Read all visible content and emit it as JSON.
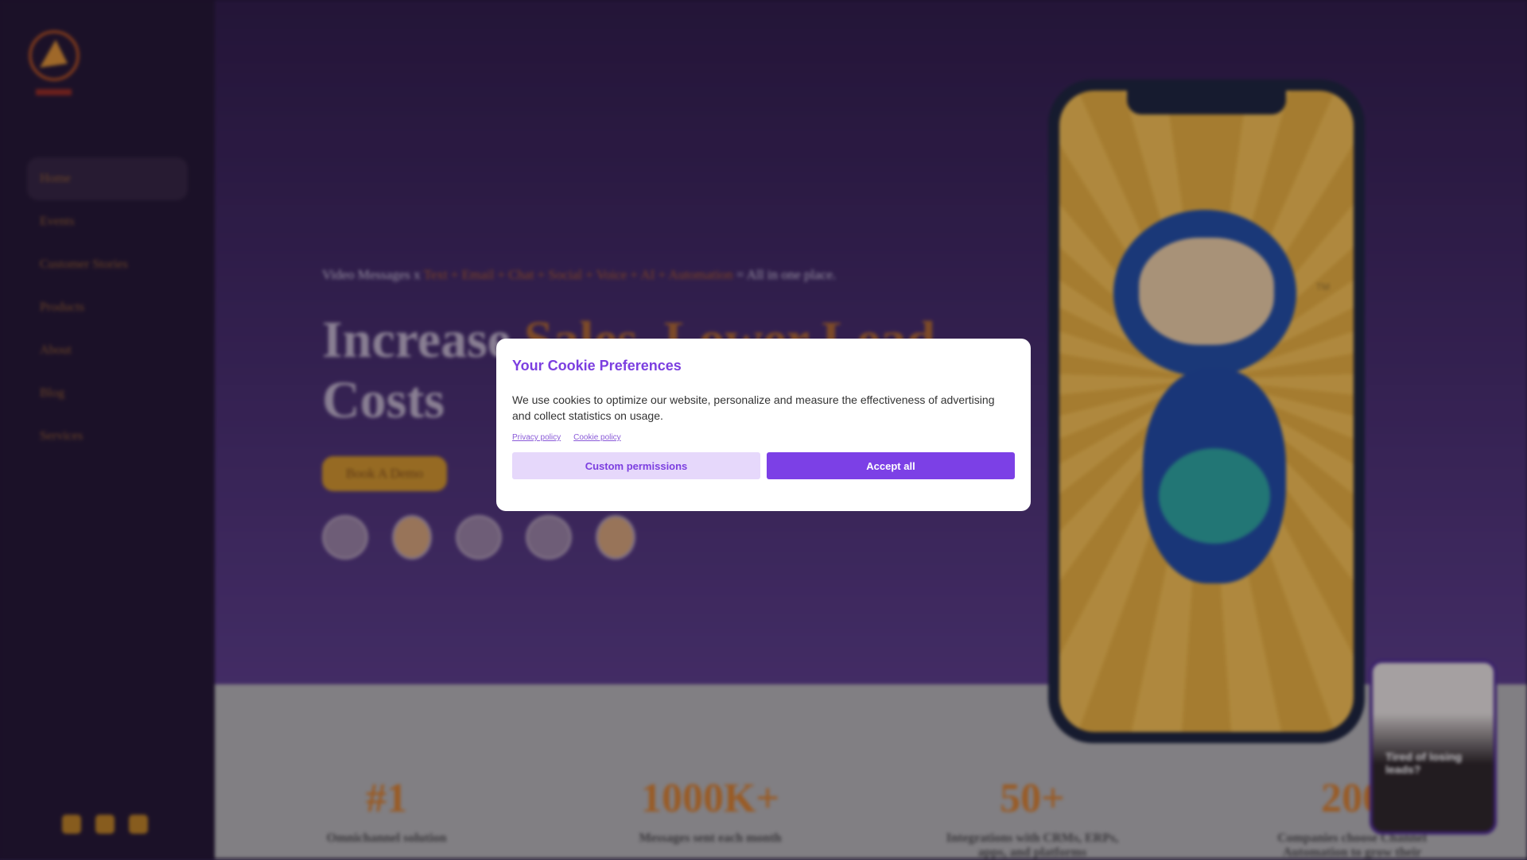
{
  "sidebar": {
    "items": [
      {
        "label": "Home",
        "active": true
      },
      {
        "label": "Events"
      },
      {
        "label": "Customer Stories"
      },
      {
        "label": "Products"
      },
      {
        "label": "About"
      },
      {
        "label": "Blog"
      },
      {
        "label": "Services"
      }
    ],
    "socials": [
      "facebook-icon",
      "twitter-icon",
      "youtube-icon"
    ]
  },
  "hero": {
    "tagline_start": "Video Messages x ",
    "tagline_highlight": "Text + Email + Chat + Social + Voice + AI + Automation",
    "tagline_end": " = All in one place.",
    "headline_start": "Increase ",
    "headline_highlight": "Sales, Lower Lead",
    "headline_end": "Costs",
    "cta": "Book A Demo",
    "mascot_tm": "TM"
  },
  "stats": [
    {
      "num": "#1",
      "label": "Omnichannel solution"
    },
    {
      "num": "1000K+",
      "label": "Messages sent each month"
    },
    {
      "num": "50+",
      "label": "Integrations with CRMs, ERPs, apps, and platforms"
    },
    {
      "num": "200",
      "label": "Companies choose Channel Automation to grow their"
    }
  ],
  "video_widget": {
    "caption": "Tired of losing leads?"
  },
  "cookie": {
    "title": "Your Cookie Preferences",
    "body": "We use cookies to optimize our website, personalize and measure the effectiveness of advertising and collect statistics on usage.",
    "privacy": "Privacy policy",
    "cookie_policy": "Cookie policy",
    "custom": "Custom permissions",
    "accept": "Accept all"
  },
  "colors": {
    "accent": "#7c40e6",
    "brand_orange": "#c48d28"
  }
}
